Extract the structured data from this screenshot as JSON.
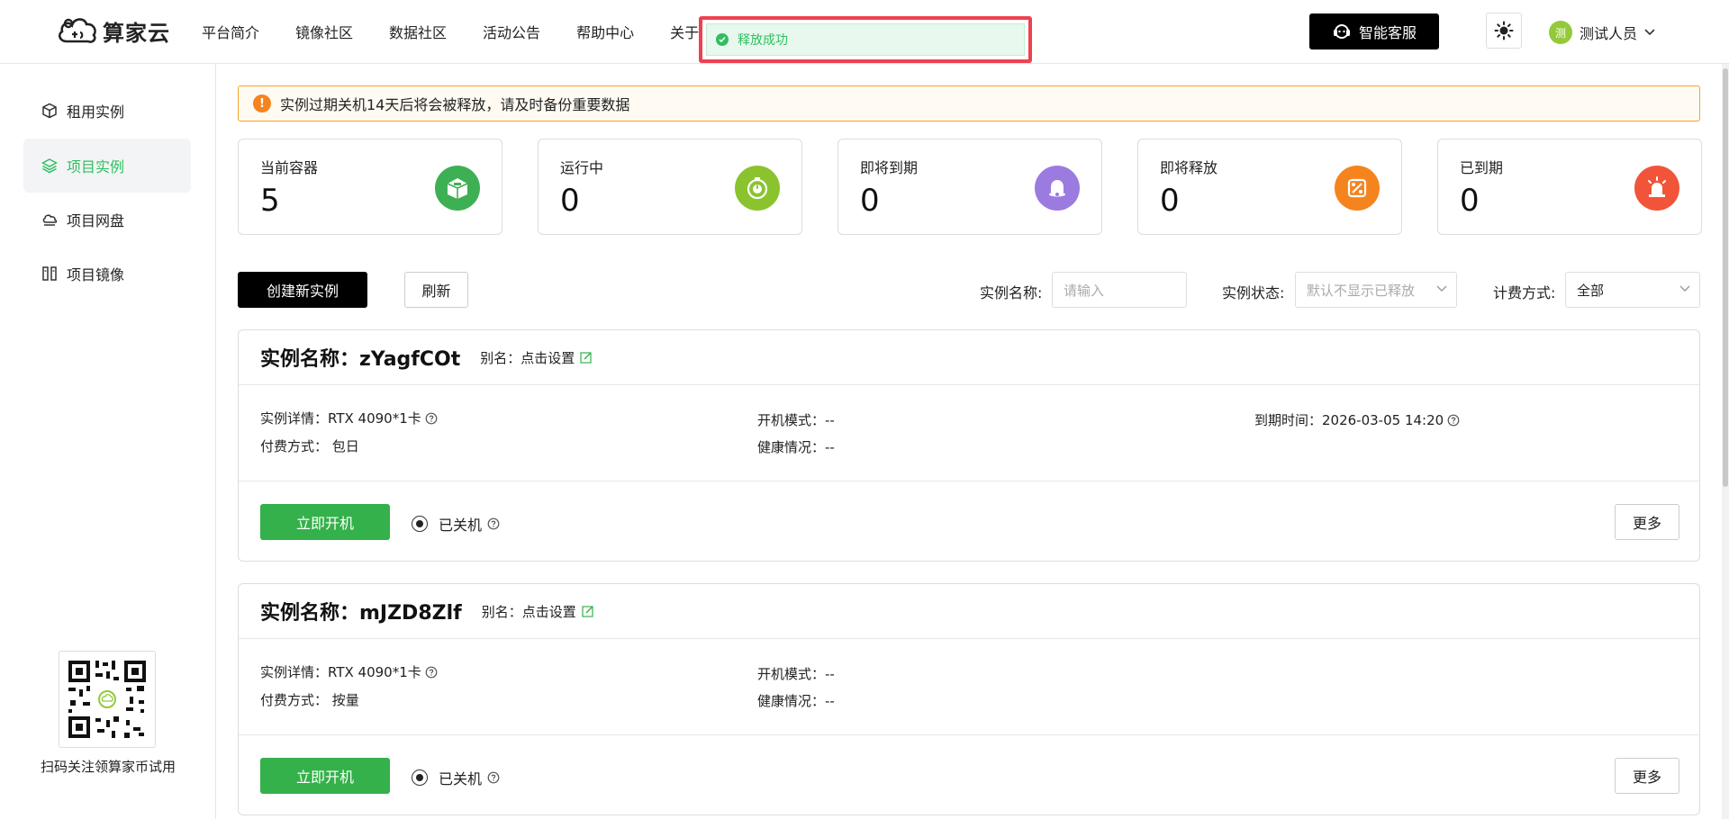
{
  "header": {
    "logo_text": "算家云",
    "nav": [
      "平台简介",
      "镜像社区",
      "数据社区",
      "活动公告",
      "帮助中心",
      "关于"
    ],
    "toast": "释放成功",
    "support_label": "智能客服",
    "user_avatar": "测",
    "user_name": "测试人员"
  },
  "sidebar": {
    "items": [
      {
        "label": "租用实例",
        "icon": "cube-icon"
      },
      {
        "label": "项目实例",
        "icon": "layers-icon",
        "active": true
      },
      {
        "label": "项目网盘",
        "icon": "cloud-disk-icon"
      },
      {
        "label": "项目镜像",
        "icon": "image-icon"
      }
    ],
    "qr_caption": "扫码关注领算家币试用"
  },
  "notice": "实例过期关机14天后将会被释放，请及时备份重要数据",
  "stats": [
    {
      "label": "当前容器",
      "value": "5",
      "color": "#3eb054"
    },
    {
      "label": "运行中",
      "value": "0",
      "color": "#8bc32e"
    },
    {
      "label": "即将到期",
      "value": "0",
      "color": "#9c7be0"
    },
    {
      "label": "即将释放",
      "value": "0",
      "color": "#f5841f"
    },
    {
      "label": "已到期",
      "value": "0",
      "color": "#f2543a"
    }
  ],
  "toolbar": {
    "create_label": "创建新实例",
    "refresh_label": "刷新",
    "name_label": "实例名称:",
    "name_placeholder": "请输入",
    "status_label": "实例状态:",
    "status_placeholder": "默认不显示已释放",
    "billing_label": "计费方式:",
    "billing_value": "全部"
  },
  "cards": [
    {
      "title": "实例名称：zYagfCOt",
      "alias": "别名：点击设置",
      "detail": "实例详情：RTX 4090*1卡",
      "pay": "付费方式：  包日",
      "boot_mode": "开机模式：--",
      "health": "健康情况：--",
      "expire": "到期时间：2026-03-05 14:20",
      "start_label": "立即开机",
      "status": "已关机",
      "more_label": "更多"
    },
    {
      "title": "实例名称：mJZD8Zlf",
      "alias": "别名：点击设置",
      "detail": "实例详情：RTX 4090*1卡",
      "pay": "付费方式：  按量",
      "boot_mode": "开机模式：--",
      "health": "健康情况：--",
      "expire": "",
      "start_label": "立即开机",
      "status": "已关机",
      "more_label": "更多"
    }
  ]
}
